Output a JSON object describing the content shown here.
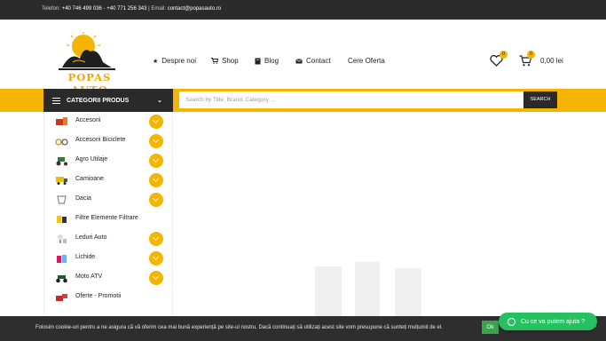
{
  "topbar": {
    "phone_label": "Telefon:",
    "phone_1": "+40 746 499 036",
    "phone_sep": " - ",
    "phone_2": "+40 771 256 343",
    "email_label": " | Email:",
    "email": "contact@popasauto.ro"
  },
  "logo": {
    "text": "POPAS AUTO"
  },
  "nav": [
    {
      "label": "Despre noi",
      "icon": "star-icon"
    },
    {
      "label": "Shop",
      "icon": "cart-icon"
    },
    {
      "label": "Blog",
      "icon": "book-icon"
    },
    {
      "label": "Contact",
      "icon": "envelope-icon"
    },
    {
      "label": "Cere Oferta",
      "icon": ""
    }
  ],
  "header_icons": {
    "wishlist_count": "0",
    "cart_count": "0",
    "cart_total": "0,00 lei"
  },
  "categories_toggle": {
    "label": "CATEGORII PRODUS"
  },
  "search": {
    "placeholder": "Search by Title, Brand, Category ...",
    "button": "SEARCH"
  },
  "categories": [
    {
      "label": "Accesorii",
      "expandable": true
    },
    {
      "label": "Accesorii Biciclete",
      "expandable": true
    },
    {
      "label": "Agro Utilaje",
      "expandable": true
    },
    {
      "label": "Camioane",
      "expandable": true
    },
    {
      "label": "Dacia",
      "expandable": true
    },
    {
      "label": "Filtre Elemente Filtrare",
      "expandable": false
    },
    {
      "label": "Leduri Auto",
      "expandable": true
    },
    {
      "label": "Lichide",
      "expandable": true
    },
    {
      "label": "Moto ATV",
      "expandable": true
    },
    {
      "label": "Oferte - Promotii",
      "expandable": false
    }
  ],
  "cookie": {
    "text": "Folosim cookie-uri pentru a ne asigura că vă oferim cea mai bună experiență pe site-ul nostru. Dacă continuați să utilizați acest site vom presupune că sunteți mulțumit de el.",
    "ok": "Ok",
    "close": "✕"
  },
  "whatsapp": {
    "label": "Cu ce va putem ajuta ?"
  },
  "colors": {
    "accent": "#f5b400",
    "dark": "#2a2a2a",
    "whatsapp": "#25c160"
  }
}
